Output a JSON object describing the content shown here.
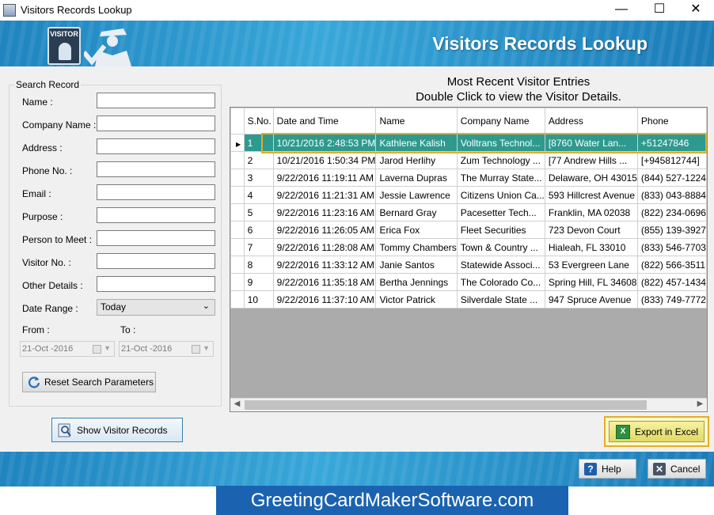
{
  "window": {
    "title": "Visitors Records Lookup",
    "minimize": "—",
    "maximize": "☐",
    "close": "✕"
  },
  "banner": {
    "title": "Visitors Records Lookup",
    "badge_text": "VISITOR"
  },
  "search": {
    "legend": "Search Record",
    "fields": [
      {
        "label": "Name :",
        "value": ""
      },
      {
        "label": "Company Name :",
        "value": ""
      },
      {
        "label": "Address :",
        "value": ""
      },
      {
        "label": "Phone No. :",
        "value": ""
      },
      {
        "label": "Email :",
        "value": ""
      },
      {
        "label": "Purpose :",
        "value": ""
      },
      {
        "label": "Person to Meet :",
        "value": ""
      },
      {
        "label": "Visitor No. :",
        "value": ""
      },
      {
        "label": "Other Details :",
        "value": ""
      }
    ],
    "date_range_label": "Date Range :",
    "date_range_value": "Today",
    "from_label": "From :",
    "to_label": "To :",
    "from_value": "21-Oct -2016",
    "to_value": "21-Oct -2016",
    "reset_label": "Reset Search Parameters"
  },
  "show_records_label": "Show Visitor Records",
  "grid": {
    "heading_line1": "Most Recent Visitor Entries",
    "heading_line2": "Double Click to view the Visitor Details.",
    "columns": [
      "S.No.",
      "Date and Time",
      "Name",
      "Company Name",
      "Address",
      "Phone"
    ],
    "rows": [
      [
        "1",
        "10/21/2016 2:48:53 PM",
        "Kathlene Kalish",
        "Volltrans Technol...",
        "[8760 Water Lan...",
        "+51247846"
      ],
      [
        "2",
        "10/21/2016 1:50:34 PM",
        "Jarod Herlihy",
        "Zum Technology ...",
        "[77 Andrew Hills ...",
        "[+945812744]"
      ],
      [
        "3",
        "9/22/2016 11:19:11 AM",
        "Laverna Dupras",
        "The Murray State...",
        "Delaware, OH 43015",
        "(844) 527-1224"
      ],
      [
        "4",
        "9/22/2016 11:21:31 AM",
        "Jessie Lawrence",
        "Citizens Union Ca...",
        "593 Hillcrest Avenue",
        "(833) 043-8884"
      ],
      [
        "5",
        "9/22/2016 11:23:16 AM",
        "Bernard Gray",
        "Pacesetter Tech...",
        "Franklin, MA 02038",
        "(822) 234-0696"
      ],
      [
        "6",
        "9/22/2016 11:26:05 AM",
        "Erica Fox",
        "Fleet Securities",
        "723 Devon Court",
        "(855) 139-3927"
      ],
      [
        "7",
        "9/22/2016 11:28:08 AM",
        "Tommy Chambers",
        "Town & Country ...",
        "Hialeah, FL 33010",
        "(833) 546-7703"
      ],
      [
        "8",
        "9/22/2016 11:33:12 AM",
        "Janie Santos",
        "Statewide Associ...",
        "53 Evergreen Lane",
        "(822) 566-3511"
      ],
      [
        "9",
        "9/22/2016 11:35:18 AM",
        "Bertha Jennings",
        "The Colorado Co...",
        "Spring Hill, FL 34608",
        "(822) 457-1434"
      ],
      [
        "10",
        "9/22/2016 11:37:10 AM",
        "Victor Patrick",
        "Silverdale State ...",
        "947 Spruce Avenue",
        "(833) 749-7772"
      ]
    ],
    "selected_row": 0
  },
  "export_label": "Export in Excel",
  "help_label": "Help",
  "cancel_label": "Cancel",
  "watermark": "GreetingCardMakerSoftware.com",
  "colors": {
    "accent": "#1f84bf",
    "selection": "#2e9a8f",
    "highlight_border": "#e1ad2a"
  }
}
